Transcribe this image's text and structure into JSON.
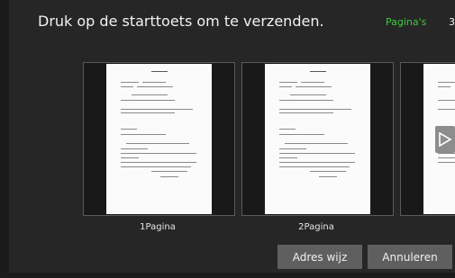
{
  "header": {
    "instruction": "Druk op de starttoets om te verzenden.",
    "pages_label": "Pagina's",
    "pages_count": "3"
  },
  "preview": {
    "pages": [
      {
        "label": "1Pagina"
      },
      {
        "label": "2Pagina"
      },
      {
        "label": ""
      }
    ]
  },
  "buttons": {
    "change_address": "Adres wijz",
    "cancel": "Annuleren"
  },
  "colors": {
    "accent": "#3fc93f",
    "background": "#262626",
    "button": "#5f5f5f"
  },
  "icons": {
    "next": "play-arrow-icon"
  }
}
